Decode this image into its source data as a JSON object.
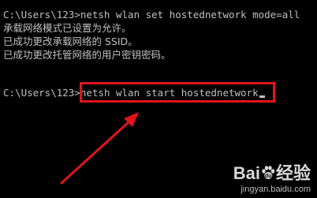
{
  "window": {
    "type": "command-prompt",
    "background": "#000000",
    "text_color": "#c0c0c0"
  },
  "console": {
    "line1": "C:\\Users\\123>netsh wlan set hostednetwork mode=all",
    "line2": "承载网络模式已设置为允许。",
    "line3": "已成功更改承载网络的 SSID。",
    "line4": "已成功更改托管网络的用户密钥密码。",
    "line5_prompt": "C:\\Users\\123>",
    "line5_command": "netsh wlan start hostednetwork"
  },
  "annotation": {
    "highlight_color": "#e0141c",
    "arrow_color": "#e0141c",
    "arrow_icon": "arrow-up-right-icon"
  },
  "watermark": {
    "brand_text_left": "Bai",
    "brand_text_right": "经验",
    "brand_icon": "paw-icon",
    "url": "jingyan.baidu.com"
  }
}
